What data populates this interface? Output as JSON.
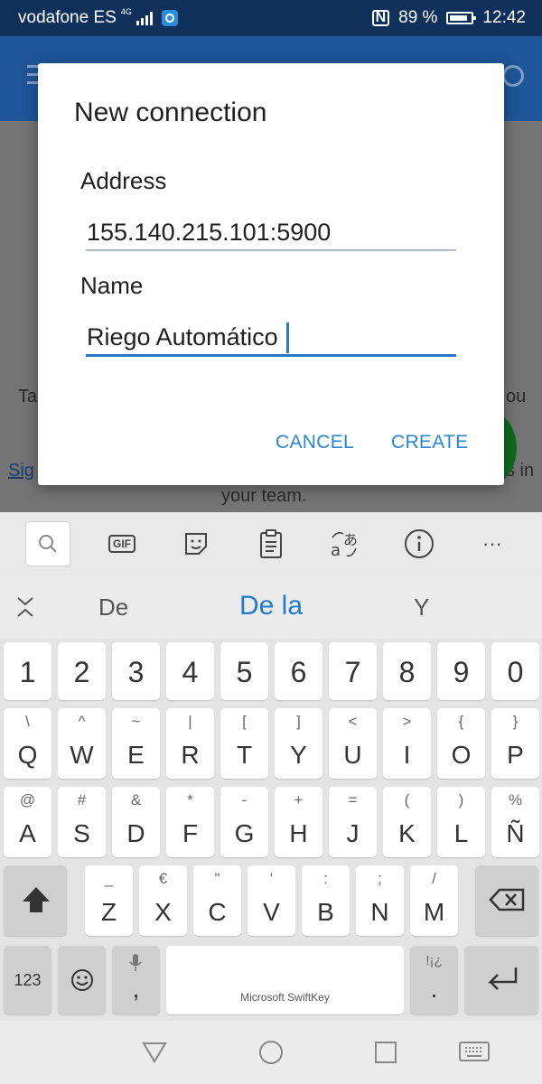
{
  "status_bar": {
    "carrier": "vodafone ES",
    "network": "4G",
    "battery": "89 %",
    "time": "12:42"
  },
  "background_app": {
    "text_left_1": "Ta",
    "text_right_1": "ou",
    "link_left": "Sig",
    "text_right_2": "s in",
    "text_bottom": "your team."
  },
  "dialog": {
    "title": "New connection",
    "address_label": "Address",
    "address_value": "155.140.215.101:5900",
    "name_label": "Name",
    "name_value": "Riego Automático",
    "cancel_label": "CANCEL",
    "create_label": "CREATE"
  },
  "keyboard": {
    "toolbar_icons": [
      "search-icon",
      "gif-icon",
      "sticker-icon",
      "clipboard-icon",
      "translate-icon",
      "info-icon",
      "more-icon"
    ],
    "gif_label": "GIF",
    "more_label": "···",
    "suggestions": [
      "De",
      "De la",
      "Y"
    ],
    "number_row": [
      "1",
      "2",
      "3",
      "4",
      "5",
      "6",
      "7",
      "8",
      "9",
      "0"
    ],
    "row1": [
      {
        "main": "Q",
        "sub": "\\"
      },
      {
        "main": "W",
        "sub": "^"
      },
      {
        "main": "E",
        "sub": "~"
      },
      {
        "main": "R",
        "sub": "|"
      },
      {
        "main": "T",
        "sub": "["
      },
      {
        "main": "Y",
        "sub": "]"
      },
      {
        "main": "U",
        "sub": "<"
      },
      {
        "main": "I",
        "sub": ">"
      },
      {
        "main": "O",
        "sub": "{"
      },
      {
        "main": "P",
        "sub": "}"
      }
    ],
    "row2": [
      {
        "main": "A",
        "sub": "@"
      },
      {
        "main": "S",
        "sub": "#"
      },
      {
        "main": "D",
        "sub": "&"
      },
      {
        "main": "F",
        "sub": "*"
      },
      {
        "main": "G",
        "sub": "-"
      },
      {
        "main": "H",
        "sub": "+"
      },
      {
        "main": "J",
        "sub": "="
      },
      {
        "main": "K",
        "sub": "("
      },
      {
        "main": "L",
        "sub": ")"
      },
      {
        "main": "Ñ",
        "sub": "%"
      }
    ],
    "row3": [
      {
        "main": "Z",
        "sub": "_"
      },
      {
        "main": "X",
        "sub": "€"
      },
      {
        "main": "C",
        "sub": "\""
      },
      {
        "main": "V",
        "sub": "'"
      },
      {
        "main": "B",
        "sub": ":"
      },
      {
        "main": "N",
        "sub": ";"
      },
      {
        "main": "M",
        "sub": "/"
      }
    ],
    "symbols_label": "123",
    "comma_label": ",",
    "space_label": "Microsoft SwiftKey",
    "period_label": ".",
    "period_sub": "!¡¿"
  },
  "colors": {
    "status_bar": "#10305c",
    "accent": "#2a86d0",
    "toolbar": "#1f5599"
  }
}
